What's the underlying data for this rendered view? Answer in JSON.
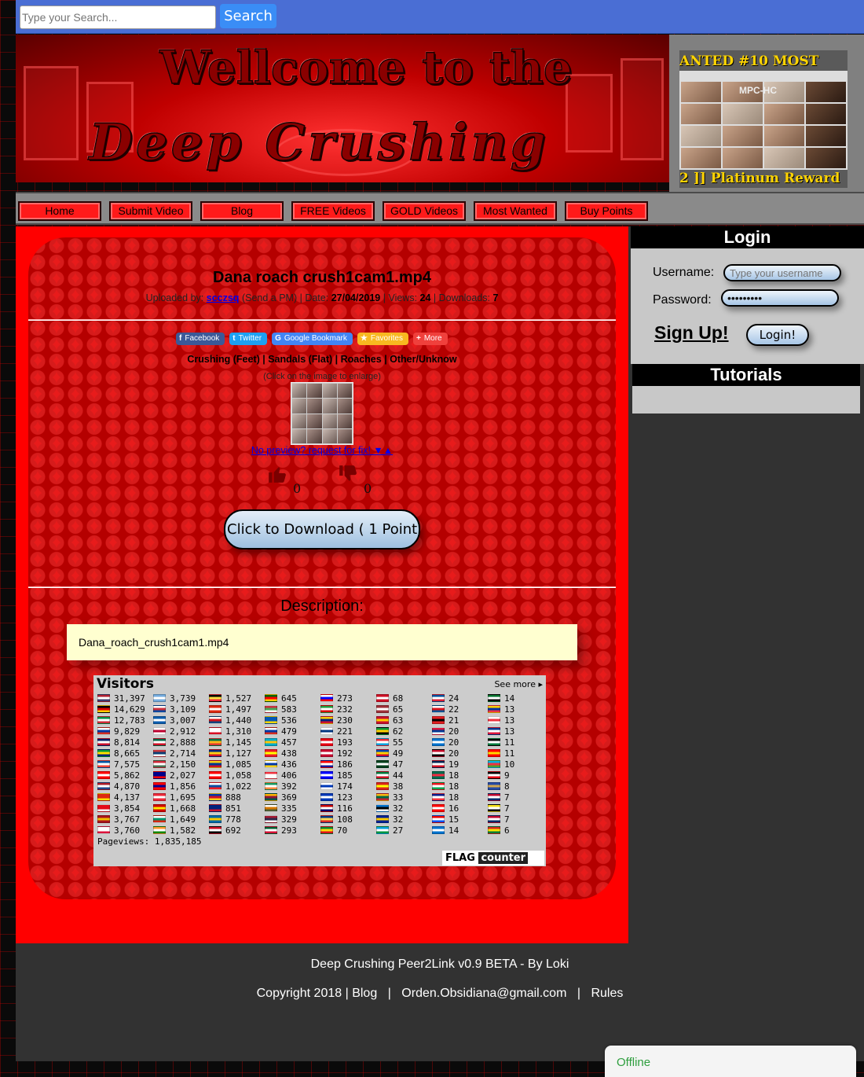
{
  "search": {
    "placeholder": "Type your Search...",
    "button_label": "Search"
  },
  "banner": {
    "line1": "Wellcome to the",
    "line2": "Deep Crushing"
  },
  "ad": {
    "top_text": "ANTED #10    MOST",
    "caption": "MPC-HC",
    "bottom_text": "2 ]] Platinum    Reward"
  },
  "nav": {
    "items": [
      {
        "label": "Home"
      },
      {
        "label": "Submit Video"
      },
      {
        "label": "Blog"
      },
      {
        "label": "FREE Videos"
      },
      {
        "label": "GOLD Videos"
      },
      {
        "label": "Most Wanted"
      },
      {
        "label": "Buy Points"
      }
    ],
    "colors": {
      "button": "#ff1a1a",
      "bar": "#8a8a8a"
    }
  },
  "file": {
    "title": "Dana roach crush1cam1.mp4",
    "uploaded_by_label": "Uploaded by:",
    "uploader": "scczsq",
    "send_pm": "(Send a PM)",
    "date_label": "| Date:",
    "date": "27/04/2019",
    "views_label": "| Views:",
    "views": "24",
    "downloads_label": "| Downloads:",
    "downloads": "7"
  },
  "share": [
    {
      "label": "Facebook",
      "icon": "facebook-icon",
      "color": "#3b5998",
      "glyph": "f"
    },
    {
      "label": "Twitter",
      "icon": "twitter-icon",
      "color": "#1da1f2",
      "glyph": "t"
    },
    {
      "label": "Google Bookmark",
      "icon": "google-icon",
      "color": "#4285f4",
      "glyph": "G"
    },
    {
      "label": "Favorites",
      "icon": "star-icon",
      "color": "#f8b820",
      "glyph": "★"
    },
    {
      "label": "More",
      "icon": "plus-icon",
      "color": "#f0403c",
      "glyph": "+"
    }
  ],
  "categories": "Crushing (Feet) | Sandals (Flat) | Roaches | Other/Unknow",
  "click_hint": "(Click on the image to enlarge)",
  "no_preview_link": "No preview? request for fix! ▼▲",
  "votes": {
    "likes": "0",
    "dislikes": "0"
  },
  "download_button": "Click to Download ( 1 Point",
  "description": {
    "label": "Description:",
    "text": "Dana_roach_crush1cam1.mp4"
  },
  "visitors": {
    "title": "Visitors",
    "see_more": "See more",
    "pageviews_label": "Pageviews:",
    "pageviews": "1,835,185",
    "logo_text": "FLAG",
    "logo_counter": "counter",
    "columns": [
      [
        {
          "count": "31,397",
          "flag": [
            "#b22234",
            "#ffffff",
            "#3c3b6e"
          ]
        },
        {
          "count": "14,629",
          "flag": [
            "#000000",
            "#dd0000",
            "#ffce00"
          ]
        },
        {
          "count": "12,783",
          "flag": [
            "#009246",
            "#ffffff",
            "#ce2b37"
          ]
        },
        {
          "count": "9,829",
          "flag": [
            "#ffffff",
            "#0039a6",
            "#d52b1e"
          ]
        },
        {
          "count": "8,814",
          "flag": [
            "#012169",
            "#ffffff",
            "#c8102e"
          ]
        },
        {
          "count": "8,665",
          "flag": [
            "#009c3b",
            "#ffdf00",
            "#002776"
          ]
        },
        {
          "count": "7,575",
          "flag": [
            "#0055a4",
            "#ffffff",
            "#ef4135"
          ]
        },
        {
          "count": "5,862",
          "flag": [
            "#ff0000",
            "#ffffff",
            "#ff0000"
          ]
        },
        {
          "count": "4,870",
          "flag": [
            "#ae1c28",
            "#ffffff",
            "#21468b"
          ]
        },
        {
          "count": "4,137",
          "flag": [
            "#de2910",
            "#de2910",
            "#ffde00"
          ]
        },
        {
          "count": "3,854",
          "flag": [
            "#e30a17",
            "#e30a17",
            "#ffffff"
          ]
        },
        {
          "count": "3,767",
          "flag": [
            "#aa151b",
            "#f1bf00",
            "#aa151b"
          ]
        },
        {
          "count": "3,760",
          "flag": [
            "#ffffff",
            "#ffffff",
            "#dc143c"
          ]
        }
      ],
      [
        {
          "count": "3,739",
          "flag": [
            "#74acdf",
            "#ffffff",
            "#74acdf"
          ]
        },
        {
          "count": "3,109",
          "flag": [
            "#ffffff",
            "#cd2e3a",
            "#0047a0"
          ]
        },
        {
          "count": "3,007",
          "flag": [
            "#0d5eaf",
            "#ffffff",
            "#0d5eaf"
          ]
        },
        {
          "count": "2,912",
          "flag": [
            "#ffffff",
            "#bc002d",
            "#ffffff"
          ]
        },
        {
          "count": "2,888",
          "flag": [
            "#006847",
            "#ffffff",
            "#ce1126"
          ]
        },
        {
          "count": "2,714",
          "flag": [
            "#c6363c",
            "#0c4076",
            "#ffffff"
          ]
        },
        {
          "count": "2,150",
          "flag": [
            "#ce2939",
            "#ffffff",
            "#477050"
          ]
        },
        {
          "count": "2,027",
          "flag": [
            "#00008b",
            "#00008b",
            "#ff0000"
          ]
        },
        {
          "count": "1,856",
          "flag": [
            "#fe0000",
            "#000095",
            "#fe0000"
          ]
        },
        {
          "count": "1,695",
          "flag": [
            "#ed2939",
            "#ffffff",
            "#ed2939"
          ]
        },
        {
          "count": "1,668",
          "flag": [
            "#d20000",
            "#ffe600",
            "#d20000"
          ]
        },
        {
          "count": "1,649",
          "flag": [
            "#ffffff",
            "#00966e",
            "#d62612"
          ]
        },
        {
          "count": "1,582",
          "flag": [
            "#ff9933",
            "#ffffff",
            "#138808"
          ]
        }
      ],
      [
        {
          "count": "1,527",
          "flag": [
            "#000000",
            "#fae042",
            "#ed2939"
          ]
        },
        {
          "count": "1,497",
          "flag": [
            "#de2910",
            "#ffffff",
            "#de2910"
          ]
        },
        {
          "count": "1,440",
          "flag": [
            "#ffffff",
            "#d7141a",
            "#11457e"
          ]
        },
        {
          "count": "1,310",
          "flag": [
            "#ffffff",
            "#ffffff",
            "#d91023"
          ]
        },
        {
          "count": "1,145",
          "flag": [
            "#007749",
            "#ffb81c",
            "#de3831"
          ]
        },
        {
          "count": "1,127",
          "flag": [
            "#002b7f",
            "#fcd116",
            "#ce1126"
          ]
        },
        {
          "count": "1,085",
          "flag": [
            "#fcd116",
            "#003893",
            "#ce1126"
          ]
        },
        {
          "count": "1,058",
          "flag": [
            "#ff0000",
            "#ffffff",
            "#ff0000"
          ]
        },
        {
          "count": "1,022",
          "flag": [
            "#ffffff",
            "#0b4ea2",
            "#ee1c25"
          ]
        },
        {
          "count": "888",
          "flag": [
            "#0038a8",
            "#ce1126",
            "#fcd116"
          ]
        },
        {
          "count": "851",
          "flag": [
            "#00247d",
            "#00247d",
            "#cc142b"
          ]
        },
        {
          "count": "778",
          "flag": [
            "#006aa7",
            "#fecc00",
            "#006aa7"
          ]
        },
        {
          "count": "692",
          "flag": [
            "#ce1126",
            "#ffffff",
            "#000000"
          ]
        }
      ],
      [
        {
          "count": "645",
          "flag": [
            "#006600",
            "#ff0000",
            "#ffcc00"
          ]
        },
        {
          "count": "583",
          "flag": [
            "#c8313e",
            "#4aa657",
            "#ffffff"
          ]
        },
        {
          "count": "536",
          "flag": [
            "#0057b7",
            "#0057b7",
            "#ffd700"
          ]
        },
        {
          "count": "479",
          "flag": [
            "#ffffff",
            "#0039a6",
            "#d52b1e"
          ]
        },
        {
          "count": "457",
          "flag": [
            "#00afca",
            "#fec50c",
            "#00afca"
          ]
        },
        {
          "count": "438",
          "flag": [
            "#ee1c25",
            "#ffff00",
            "#ee1c25"
          ]
        },
        {
          "count": "436",
          "flag": [
            "#ffffff",
            "#0038a8",
            "#fcd116"
          ]
        },
        {
          "count": "406",
          "flag": [
            "#ef3340",
            "#ffffff",
            "#ffffff"
          ]
        },
        {
          "count": "392",
          "flag": [
            "#169b62",
            "#ffffff",
            "#ff883e"
          ]
        },
        {
          "count": "369",
          "flag": [
            "#ffb700",
            "#8d153a",
            "#005641"
          ]
        },
        {
          "count": "335",
          "flag": [
            "#ffffff",
            "#d57800",
            "#4e5b31"
          ]
        },
        {
          "count": "329",
          "flag": [
            "#a51931",
            "#2d2a4a",
            "#f4f5f8"
          ]
        },
        {
          "count": "293",
          "flag": [
            "#006233",
            "#ffffff",
            "#d21034"
          ]
        }
      ],
      [
        {
          "count": "273",
          "flag": [
            "#ffffff",
            "#0000ff",
            "#ff0000"
          ]
        },
        {
          "count": "232",
          "flag": [
            "#239f40",
            "#ffffff",
            "#da0000"
          ]
        },
        {
          "count": "230",
          "flag": [
            "#ffcc00",
            "#00247d",
            "#cf142b"
          ]
        },
        {
          "count": "221",
          "flag": [
            "#ffffff",
            "#003580",
            "#ffffff"
          ]
        },
        {
          "count": "193",
          "flag": [
            "#e70013",
            "#ffffff",
            "#e70013"
          ]
        },
        {
          "count": "192",
          "flag": [
            "#c60c30",
            "#ffffff",
            "#c60c30"
          ]
        },
        {
          "count": "186",
          "flag": [
            "#ff0000",
            "#ffffff",
            "#171796"
          ]
        },
        {
          "count": "185",
          "flag": [
            "#0000ff",
            "#ffffff",
            "#0000ff"
          ]
        },
        {
          "count": "174",
          "flag": [
            "#ffffff",
            "#0038b8",
            "#ffffff"
          ]
        },
        {
          "count": "123",
          "flag": [
            "#0038b8",
            "#ffffff",
            "#0038b8"
          ]
        },
        {
          "count": "116",
          "flag": [
            "#cc0001",
            "#ffffff",
            "#010066"
          ]
        },
        {
          "count": "108",
          "flag": [
            "#003882",
            "#fcd856",
            "#d62828"
          ]
        },
        {
          "count": "70",
          "flag": [
            "#078930",
            "#fcdd09",
            "#da121a"
          ]
        }
      ],
      [
        {
          "count": "68",
          "flag": [
            "#ce1126",
            "#ffffff",
            "#ce1126"
          ]
        },
        {
          "count": "65",
          "flag": [
            "#9e3039",
            "#ffffff",
            "#9e3039"
          ]
        },
        {
          "count": "63",
          "flag": [
            "#c8102e",
            "#ffcd00",
            "#c8102e"
          ]
        },
        {
          "count": "62",
          "flag": [
            "#009b3a",
            "#fed100",
            "#000000"
          ]
        },
        {
          "count": "55",
          "flag": [
            "#ed2939",
            "#ffffff",
            "#00a1de"
          ]
        },
        {
          "count": "49",
          "flag": [
            "#0046ae",
            "#ffd200",
            "#cc092f"
          ]
        },
        {
          "count": "47",
          "flag": [
            "#01411c",
            "#ffffff",
            "#01411c"
          ]
        },
        {
          "count": "44",
          "flag": [
            "#007a3d",
            "#ffffff",
            "#ce1126"
          ]
        },
        {
          "count": "38",
          "flag": [
            "#da251d",
            "#ffff00",
            "#da251d"
          ]
        },
        {
          "count": "33",
          "flag": [
            "#fdb913",
            "#006a44",
            "#c1272d"
          ]
        },
        {
          "count": "32",
          "flag": [
            "#0072ce",
            "#000000",
            "#ffffff"
          ]
        },
        {
          "count": "32",
          "flag": [
            "#002395",
            "#fecb00",
            "#002395"
          ]
        },
        {
          "count": "27",
          "flag": [
            "#00a3dd",
            "#ffffff",
            "#009543"
          ]
        }
      ],
      [
        {
          "count": "24",
          "flag": [
            "#02529c",
            "#ffffff",
            "#dc1e35"
          ]
        },
        {
          "count": "22",
          "flag": [
            "#ffffff",
            "#da121a",
            "#005293"
          ]
        },
        {
          "count": "21",
          "flag": [
            "#e41e20",
            "#000000",
            "#e41e20"
          ]
        },
        {
          "count": "20",
          "flag": [
            "#dc143c",
            "#003893",
            "#ffffff"
          ]
        },
        {
          "count": "20",
          "flag": [
            "#0073cf",
            "#ffffff",
            "#0073cf"
          ]
        },
        {
          "count": "20",
          "flag": [
            "#c8102e",
            "#ffffff",
            "#000000"
          ]
        },
        {
          "count": "19",
          "flag": [
            "#002654",
            "#ffffff",
            "#ce1126"
          ]
        },
        {
          "count": "18",
          "flag": [
            "#006a4e",
            "#f42a41",
            "#006a4e"
          ]
        },
        {
          "count": "18",
          "flag": [
            "#ee161f",
            "#ffffff",
            "#00a651"
          ]
        },
        {
          "count": "18",
          "flag": [
            "#0c1c8c",
            "#ffffff",
            "#ef3340"
          ]
        },
        {
          "count": "16",
          "flag": [
            "#ff0000",
            "#ffffff",
            "#ff0000"
          ]
        },
        {
          "count": "15",
          "flag": [
            "#ed0000",
            "#ffffff",
            "#0050f0"
          ]
        },
        {
          "count": "14",
          "flag": [
            "#0073cf",
            "#ffffff",
            "#0073cf"
          ]
        }
      ],
      [
        {
          "count": "14",
          "flag": [
            "#00732f",
            "#ffffff",
            "#000000"
          ]
        },
        {
          "count": "13",
          "flag": [
            "#ffd100",
            "#0033a0",
            "#ef3340"
          ]
        },
        {
          "count": "13",
          "flag": [
            "#ffffff",
            "#ef3340",
            "#ffffff"
          ]
        },
        {
          "count": "13",
          "flag": [
            "#003893",
            "#ffffff",
            "#dc143c"
          ]
        },
        {
          "count": "11",
          "flag": [
            "#000000",
            "#ffffff",
            "#007a3d"
          ]
        },
        {
          "count": "11",
          "flag": [
            "#ff0000",
            "#ffd700",
            "#ff0000"
          ]
        },
        {
          "count": "10",
          "flag": [
            "#00b5e2",
            "#ef3340",
            "#509e2f"
          ]
        },
        {
          "count": "9",
          "flag": [
            "#000000",
            "#ffffff",
            "#e30a17"
          ]
        },
        {
          "count": "8",
          "flag": [
            "#244aa5",
            "#d0a650",
            "#244aa5"
          ]
        },
        {
          "count": "7",
          "flag": [
            "#bf0a30",
            "#ffffff",
            "#002868"
          ]
        },
        {
          "count": "7",
          "flag": [
            "#f7e017",
            "#ffffff",
            "#000000"
          ]
        },
        {
          "count": "7",
          "flag": [
            "#bf0a30",
            "#ffffff",
            "#002868"
          ]
        },
        {
          "count": "6",
          "flag": [
            "#d52b1e",
            "#f9e300",
            "#007934"
          ]
        }
      ]
    ]
  },
  "login": {
    "title": "Login",
    "username_label": "Username:",
    "username_placeholder": "Type your username",
    "password_label": "Password:",
    "password_value": "•••••••••",
    "signup_label": "Sign Up!",
    "login_button": "Login!"
  },
  "tutorials": {
    "title": "Tutorials"
  },
  "footer": {
    "line1": "Deep Crushing Peer2Link v0.9 BETA - By Loki",
    "copyright": "Copyright 2018 |",
    "blog": "Blog",
    "sep": "|",
    "email": "Orden.Obsidiana@gmail.com",
    "rules": "Rules"
  },
  "chat": {
    "status": "Offline"
  }
}
